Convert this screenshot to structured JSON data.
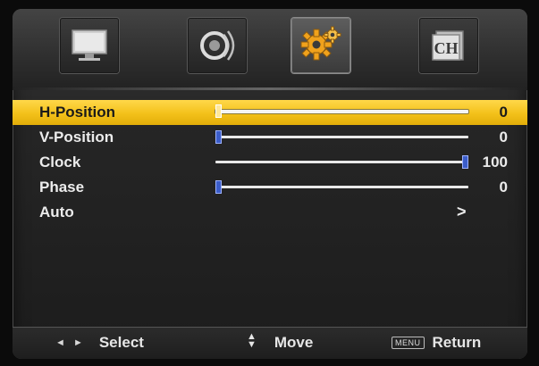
{
  "tabs": [
    {
      "icon": "tv-picture-icon",
      "active": false
    },
    {
      "icon": "speaker-sound-icon",
      "active": false
    },
    {
      "icon": "gear-setup-icon",
      "active": true
    },
    {
      "icon": "channel-ch-icon",
      "active": false
    }
  ],
  "tab_ch_text": "CH",
  "rows": [
    {
      "label": "H-Position",
      "value": "0",
      "fraction": 0.0,
      "selected": true
    },
    {
      "label": "V-Position",
      "value": "0",
      "fraction": 0.0,
      "selected": false
    },
    {
      "label": "Clock",
      "value": "100",
      "fraction": 1.0,
      "selected": false
    },
    {
      "label": "Phase",
      "value": "0",
      "fraction": 0.0,
      "selected": false
    },
    {
      "label": "Auto",
      "arrow": ">",
      "selected": false
    }
  ],
  "footer": {
    "select_arrows": "◄ ►",
    "select_label": "Select",
    "move_up": "▲",
    "move_down": "▼",
    "move_label": "Move",
    "menu_key": "MENU",
    "return_label": "Return"
  },
  "colors": {
    "highlight": "#f3c11a",
    "knob": "#3b5dc9",
    "text": "#ececec"
  }
}
